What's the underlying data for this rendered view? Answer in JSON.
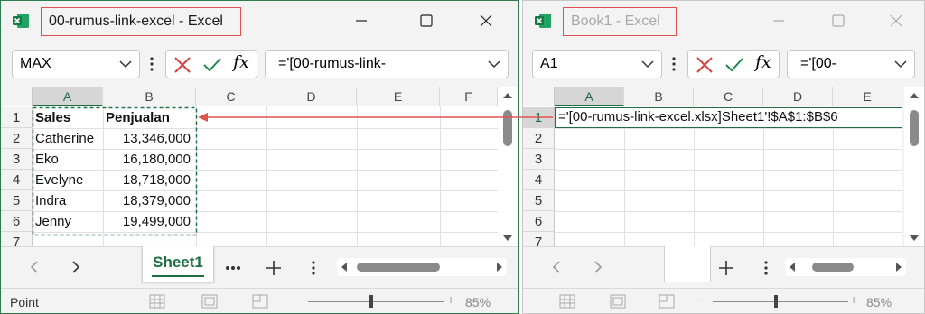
{
  "left_window": {
    "title": "00-rumus-link-excel - Excel",
    "name_box": "MAX",
    "formula": "='[00-rumus-link-",
    "columns": [
      "A",
      "B",
      "C",
      "D",
      "E",
      "F"
    ],
    "rows": [
      "1",
      "2",
      "3",
      "4",
      "5",
      "6",
      "7"
    ],
    "header": {
      "a": "Sales",
      "b": "Penjualan"
    },
    "data": [
      {
        "a": "Catherine",
        "b": "13,346,000"
      },
      {
        "a": "Eko",
        "b": "16,180,000"
      },
      {
        "a": "Evelyne",
        "b": "18,718,000"
      },
      {
        "a": "Indra",
        "b": "18,379,000"
      },
      {
        "a": "Jenny",
        "b": "19,499,000"
      }
    ],
    "sheet_tab": "Sheet1",
    "status": "Point",
    "zoom": "85%"
  },
  "right_window": {
    "title": "Book1 - Excel",
    "name_box": "A1",
    "formula": "='[00-",
    "columns": [
      "A",
      "B",
      "C",
      "D",
      "E"
    ],
    "rows": [
      "1",
      "2",
      "3",
      "4",
      "5",
      "6",
      "7"
    ],
    "a1": "='[00-rumus-link-excel.xlsx]Sheet1'!$A$1:$B$6",
    "zoom": "85%"
  },
  "colors": {
    "accent": "#1f6e43",
    "arrow": "#e05252",
    "marching_ants": "#217346"
  },
  "icons": [
    "excel-icon",
    "minimize-icon",
    "maximize-icon",
    "close-icon",
    "chevron-down-icon",
    "more-vertical-icon",
    "cancel-x-icon",
    "enter-check-icon",
    "fx-icon",
    "arrow-left-icon",
    "arrow-right-icon",
    "more-horizontal-icon",
    "plus-icon",
    "normal-view-icon",
    "page-layout-icon",
    "page-break-icon"
  ]
}
